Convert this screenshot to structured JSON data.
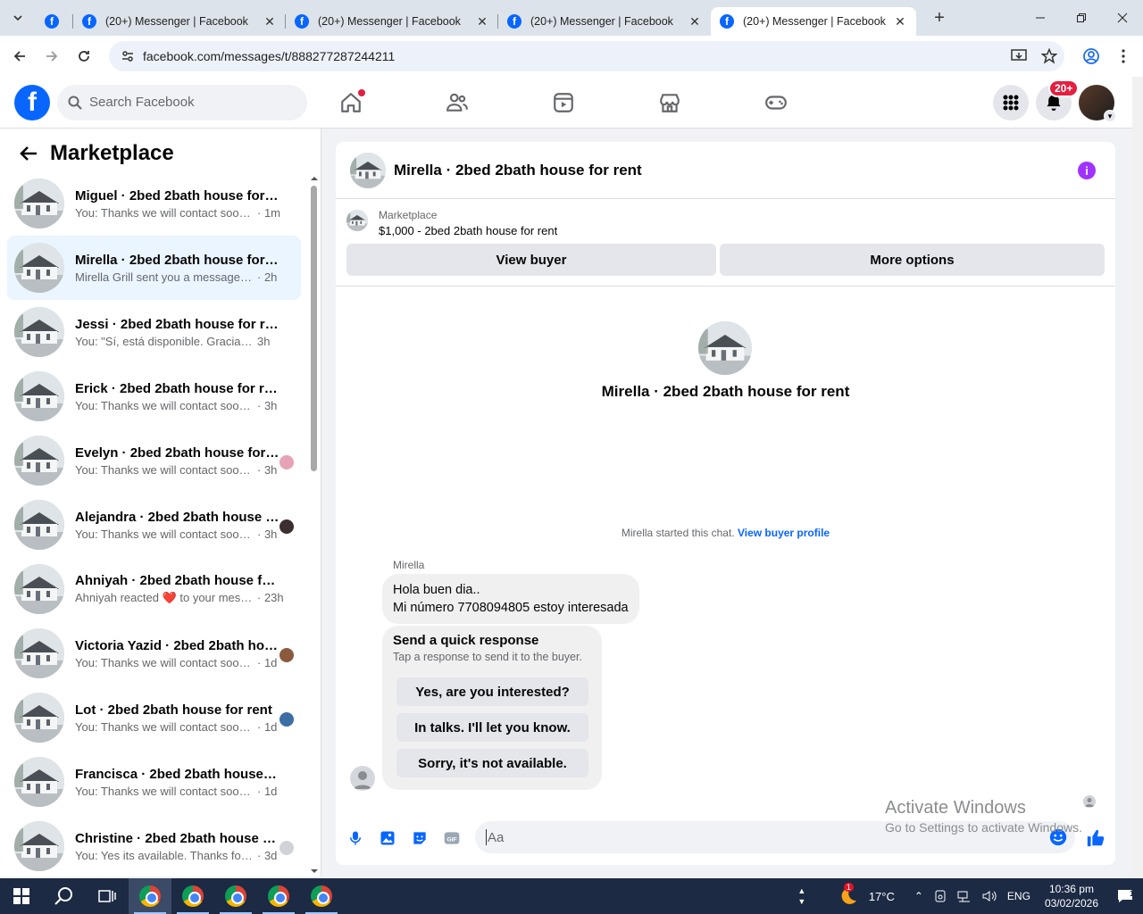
{
  "browser": {
    "tabs": [
      {
        "title": "(20+) Messenger | Facebook"
      },
      {
        "title": "(20+) Messenger | Facebook"
      },
      {
        "title": "(20+) Messenger | Facebook"
      },
      {
        "title": "(20+) Messenger | Facebook"
      }
    ],
    "url": "facebook.com/messages/t/888277287244211"
  },
  "fb": {
    "search_placeholder": "Search Facebook",
    "notif_badge": "20+"
  },
  "sidebar": {
    "title": "Marketplace",
    "conversations": [
      {
        "name": "Miguel · 2bed 2bath house for rent",
        "preview": "You: Thanks we will contact soon w...",
        "time": "· 1m"
      },
      {
        "name": "Mirella · 2bed 2bath house for rent",
        "preview": "Mirella Grill sent you a message abo...",
        "time": "· 2h"
      },
      {
        "name": "Jessi · 2bed 2bath house for rent",
        "preview": "You: \"Sí, está disponible. Gracias por...",
        "time": "3h"
      },
      {
        "name": "Erick · 2bed 2bath house for rent",
        "preview": "You: Thanks we will contact soon w...",
        "time": "· 3h"
      },
      {
        "name": "Evelyn · 2bed 2bath house for rent",
        "preview": "You: Thanks we will contact soon...",
        "time": "· 3h"
      },
      {
        "name": "Alejandra · 2bed 2bath house for rent",
        "preview": "You: Thanks we will contact soon...",
        "time": "· 3h"
      },
      {
        "name": "Ahniyah · 2bed 2bath house for rent",
        "preview": "Ahniyah reacted ❤️ to your mess...",
        "time": "· 23h"
      },
      {
        "name": "Victoria Yazid · 2bed 2bath house for rent",
        "preview": "You: Thanks we will contact soon...",
        "time": "· 1d"
      },
      {
        "name": "Lot · 2bed 2bath house for rent",
        "preview": "You: Thanks we will contact soon...",
        "time": "· 1d"
      },
      {
        "name": "Francisca · 2bed 2bath house for rent",
        "preview": "You: Thanks we will contact soon w...",
        "time": "· 1d"
      },
      {
        "name": "Christine · 2bed 2bath house for rent",
        "preview": "You: Yes its available. Thanks for c...",
        "time": "· 3d"
      }
    ]
  },
  "chat": {
    "title": "Mirella · 2bed 2bath house for rent",
    "listing_label": "Marketplace",
    "listing_price": "$1,000 - 2bed 2bath house for rent",
    "view_buyer": "View buyer",
    "more_options": "More options",
    "center_title": "Mirella · 2bed 2bath house for rent",
    "started_text": "Mirella started this chat.",
    "view_profile": "View buyer profile",
    "sender": "Mirella",
    "message_line1": "Hola buen dia..",
    "message_line2": "Mi número 7708094805 estoy interesada",
    "qr_title": "Send a quick response",
    "qr_sub": "Tap a response to send it to the buyer.",
    "qr_options": [
      "Yes, are you interested?",
      "In talks. I'll let you know.",
      "Sorry, it's not available."
    ],
    "input_placeholder": "Aa"
  },
  "watermark": {
    "line1": "Activate Windows",
    "line2": "Go to Settings to activate Windows."
  },
  "taskbar": {
    "weather": "17°C",
    "lang": "ENG",
    "time": "10:36 pm",
    "date": "03/02/2026",
    "notif_count": "1",
    "weather_badge": "1"
  }
}
